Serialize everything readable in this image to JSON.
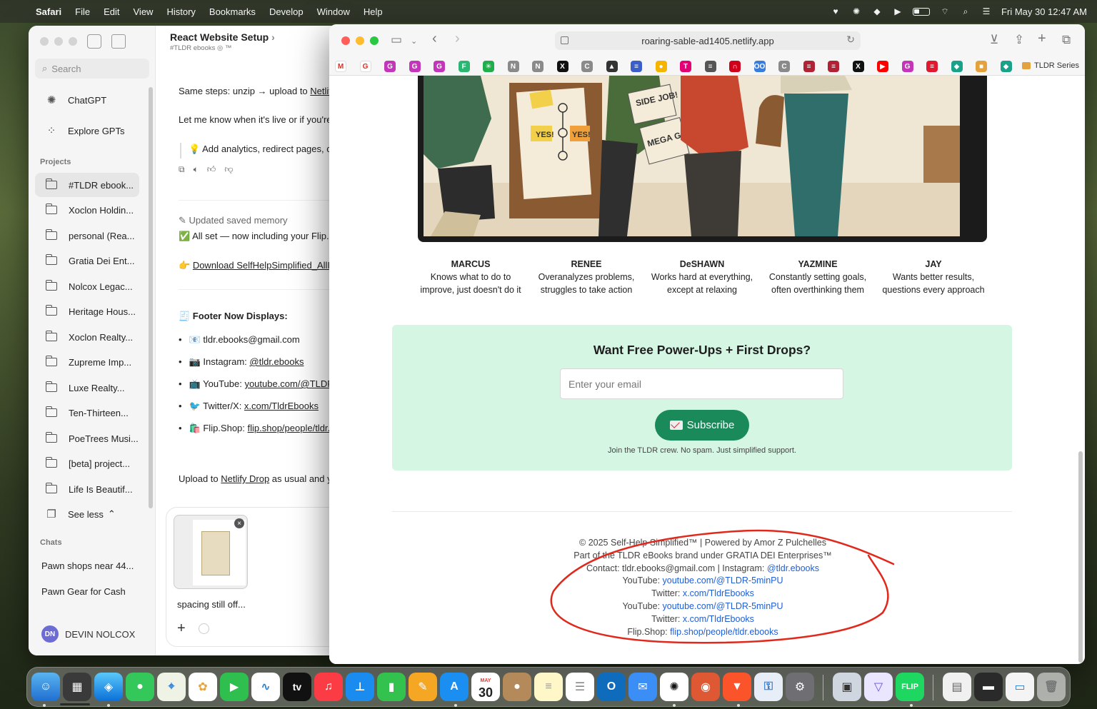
{
  "menubar": {
    "app_name": "Safari",
    "menus": [
      "File",
      "Edit",
      "View",
      "History",
      "Bookmarks",
      "Develop",
      "Window",
      "Help"
    ],
    "clock": "Fri May 30  12:47 AM"
  },
  "chatgpt": {
    "search_placeholder": "Search",
    "nav": {
      "chatgpt": "ChatGPT",
      "explore": "Explore GPTs"
    },
    "projects_label": "Projects",
    "projects": [
      "#TLDR ebook...",
      "Xoclon Holdin...",
      "personal (Rea...",
      "Gratia Dei Ent...",
      "Nolcox Legac...",
      "Heritage Hous...",
      "Xoclon Realty...",
      "Zupreme Imp...",
      "Luxe Realty...",
      "Ten-Thirteen...",
      "PoeTrees Musi...",
      "[beta] project...",
      " Life Is Beautif..."
    ],
    "see_less": "See less",
    "chats_label": "Chats",
    "chats": [
      "Pawn shops near 44...",
      "Pawn Gear for Cash"
    ],
    "user": {
      "initials": "DN",
      "name": "DEVIN NOLCOX"
    },
    "conversation": {
      "title": "React Website Setup",
      "subtitle": "#TLDR ebooks  ◎ ™",
      "line1_prefix": "Same steps: unzip → upload to ",
      "line1_link": "Netlif",
      "line2": "Let me know when it's live or if you're",
      "tip": "💡  Add analytics, redirect pages, c",
      "memory": "Updated saved memory",
      "allset": "✅  All set — now including your Flip.S",
      "download_prefix": "👉  ",
      "download_link": "Download SelfHelpSimplified_AllI",
      "footer_heading": "🧾  Footer Now Displays:",
      "bullets": [
        {
          "label": "📧  tldr.ebooks@gmail.com",
          "link": ""
        },
        {
          "label": "📷  Instagram: ",
          "link": "@tldr.ebooks"
        },
        {
          "label": "📺  YouTube: ",
          "link": "youtube.com/@TLDR"
        },
        {
          "label": "🐦  Twitter/X: ",
          "link": "x.com/TldrEbooks"
        },
        {
          "label": "🛍️  Flip.Shop: ",
          "link": "flip.shop/people/tldr."
        }
      ],
      "upload_prefix": "Upload to ",
      "upload_link": "Netlify Drop",
      "upload_suffix": " as usual and y"
    },
    "composer": {
      "attachment_label": "spacing still off..."
    }
  },
  "safari": {
    "url": "roaring-sable-ad1405.netlify.app",
    "favorites_folder": "TLDR Series",
    "favicons": [
      {
        "name": "gmail-favicon",
        "glyph": "M",
        "color": "#ffffff"
      },
      {
        "name": "google-favicon",
        "glyph": "G",
        "color": "#ffffff"
      },
      {
        "name": "g1-favicon",
        "glyph": "G",
        "color": "#c335b9"
      },
      {
        "name": "g2-favicon",
        "glyph": "G",
        "color": "#c335b9"
      },
      {
        "name": "g3-favicon",
        "glyph": "G",
        "color": "#c335b9"
      },
      {
        "name": "flag-favicon",
        "glyph": "F",
        "color": "#2bb673"
      },
      {
        "name": "leaf-favicon",
        "glyph": "✳",
        "color": "#1fae4c"
      },
      {
        "name": "n1-favicon",
        "glyph": "N",
        "color": "#8a8a8a"
      },
      {
        "name": "n2-favicon",
        "glyph": "N",
        "color": "#8a8a8a"
      },
      {
        "name": "x1-favicon",
        "glyph": "X",
        "color": "#111111"
      },
      {
        "name": "c1-favicon",
        "glyph": "C",
        "color": "#8a8a8a"
      },
      {
        "name": "peak-favicon",
        "glyph": "▲",
        "color": "#333333"
      },
      {
        "name": "flag2-favicon",
        "glyph": "≡",
        "color": "#3a5fcd"
      },
      {
        "name": "shell-favicon",
        "glyph": "●",
        "color": "#f5b400"
      },
      {
        "name": "tmobile-favicon",
        "glyph": "T",
        "color": "#e20074"
      },
      {
        "name": "news-favicon",
        "glyph": "≡",
        "color": "#555555"
      },
      {
        "name": "magnet-favicon",
        "glyph": "∩",
        "color": "#d0021b"
      },
      {
        "name": "oo-favicon",
        "glyph": "OO",
        "color": "#3b7bd9"
      },
      {
        "name": "c2-favicon",
        "glyph": "C",
        "color": "#8a8a8a"
      },
      {
        "name": "usflag1-favicon",
        "glyph": "≡",
        "color": "#b22234"
      },
      {
        "name": "usflag2-favicon",
        "glyph": "≡",
        "color": "#b22234"
      },
      {
        "name": "x2-favicon",
        "glyph": "X",
        "color": "#111111"
      },
      {
        "name": "youtube-favicon",
        "glyph": "▶",
        "color": "#ff0000"
      },
      {
        "name": "g4-favicon",
        "glyph": "G",
        "color": "#c335b9"
      },
      {
        "name": "stripes-favicon",
        "glyph": "≡",
        "color": "#e0192e"
      },
      {
        "name": "diamond1-favicon",
        "glyph": "◆",
        "color": "#19a28a"
      },
      {
        "name": "box-favicon",
        "glyph": "■",
        "color": "#e4a23c"
      },
      {
        "name": "diamond2-favicon",
        "glyph": "◆",
        "color": "#19a28a"
      }
    ],
    "page": {
      "personas": [
        {
          "name": "MARCUS",
          "desc": "Knows what to do to improve, just doesn't do it"
        },
        {
          "name": "RENEE",
          "desc": "Overanalyzes problems, struggles to take action"
        },
        {
          "name": "DeSHAWN",
          "desc": "Works hard at everything, except at relaxing"
        },
        {
          "name": "YAZMINE",
          "desc": "Constantly setting goals, often overthinking them"
        },
        {
          "name": "JAY",
          "desc": "Wants better results, questions every approach"
        }
      ],
      "signup": {
        "title": "Want Free Power-Ups + First Drops?",
        "email_placeholder": "Enter your email",
        "button": "Subscribe",
        "note": "Join the TLDR crew. No spam. Just simplified support."
      },
      "footer": {
        "copyright": "© 2025 Self-Help Simplified™ | Powered by Amor Z Pulchelles",
        "brand": "Part of the TLDR eBooks brand under GRATIA DEI Enterprises™",
        "contact_prefix": "Contact: tldr.ebooks@gmail.com | Instagram: ",
        "instagram": "@tldr.ebooks",
        "youtube_label": "YouTube: ",
        "youtube": "youtube.com/@TLDR-5minPU",
        "twitter_label": "Twitter: ",
        "twitter": "x.com/TldrEbooks",
        "flip_label": "Flip.Shop: ",
        "flip": "flip.shop/people/tldr.ebooks"
      },
      "hero_text": {
        "side_job": "SIDE JOB!",
        "mega_gig": "MEGA GIG!",
        "yes": "YES!"
      }
    }
  },
  "dock": {
    "calendar_month": "MAY",
    "calendar_day": "30",
    "tv_label": "tv",
    "flip_label": "FLIP"
  }
}
